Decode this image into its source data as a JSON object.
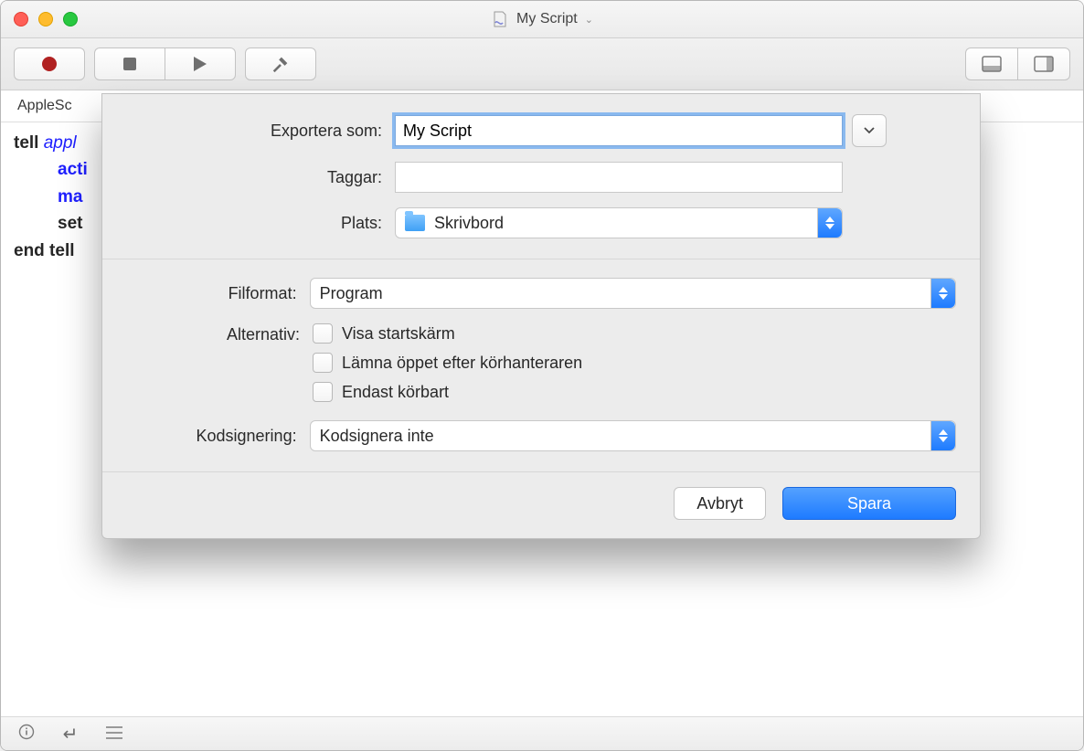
{
  "window": {
    "title": "My Script"
  },
  "langbar": {
    "label": "AppleSc"
  },
  "code": {
    "tell": "tell",
    "app_ref": "appl",
    "cmd_activate": "acti",
    "cmd_make": "ma",
    "set_line": "set",
    "end": "end tell"
  },
  "export": {
    "labels": {
      "export_as": "Exportera som:",
      "tags": "Taggar:",
      "location": "Plats:",
      "file_format": "Filformat:",
      "alternatives": "Alternativ:",
      "code_signing": "Kodsignering:"
    },
    "export_as_value": "My Script",
    "tags_value": "",
    "location_value": "Skrivbord",
    "file_format_value": "Program",
    "alternatives": {
      "show_splash": "Visa startskärm",
      "leave_open": "Lämna öppet efter körhanteraren",
      "run_only": "Endast körbart"
    },
    "code_signing_value": "Kodsignera inte",
    "buttons": {
      "cancel": "Avbryt",
      "save": "Spara"
    }
  }
}
